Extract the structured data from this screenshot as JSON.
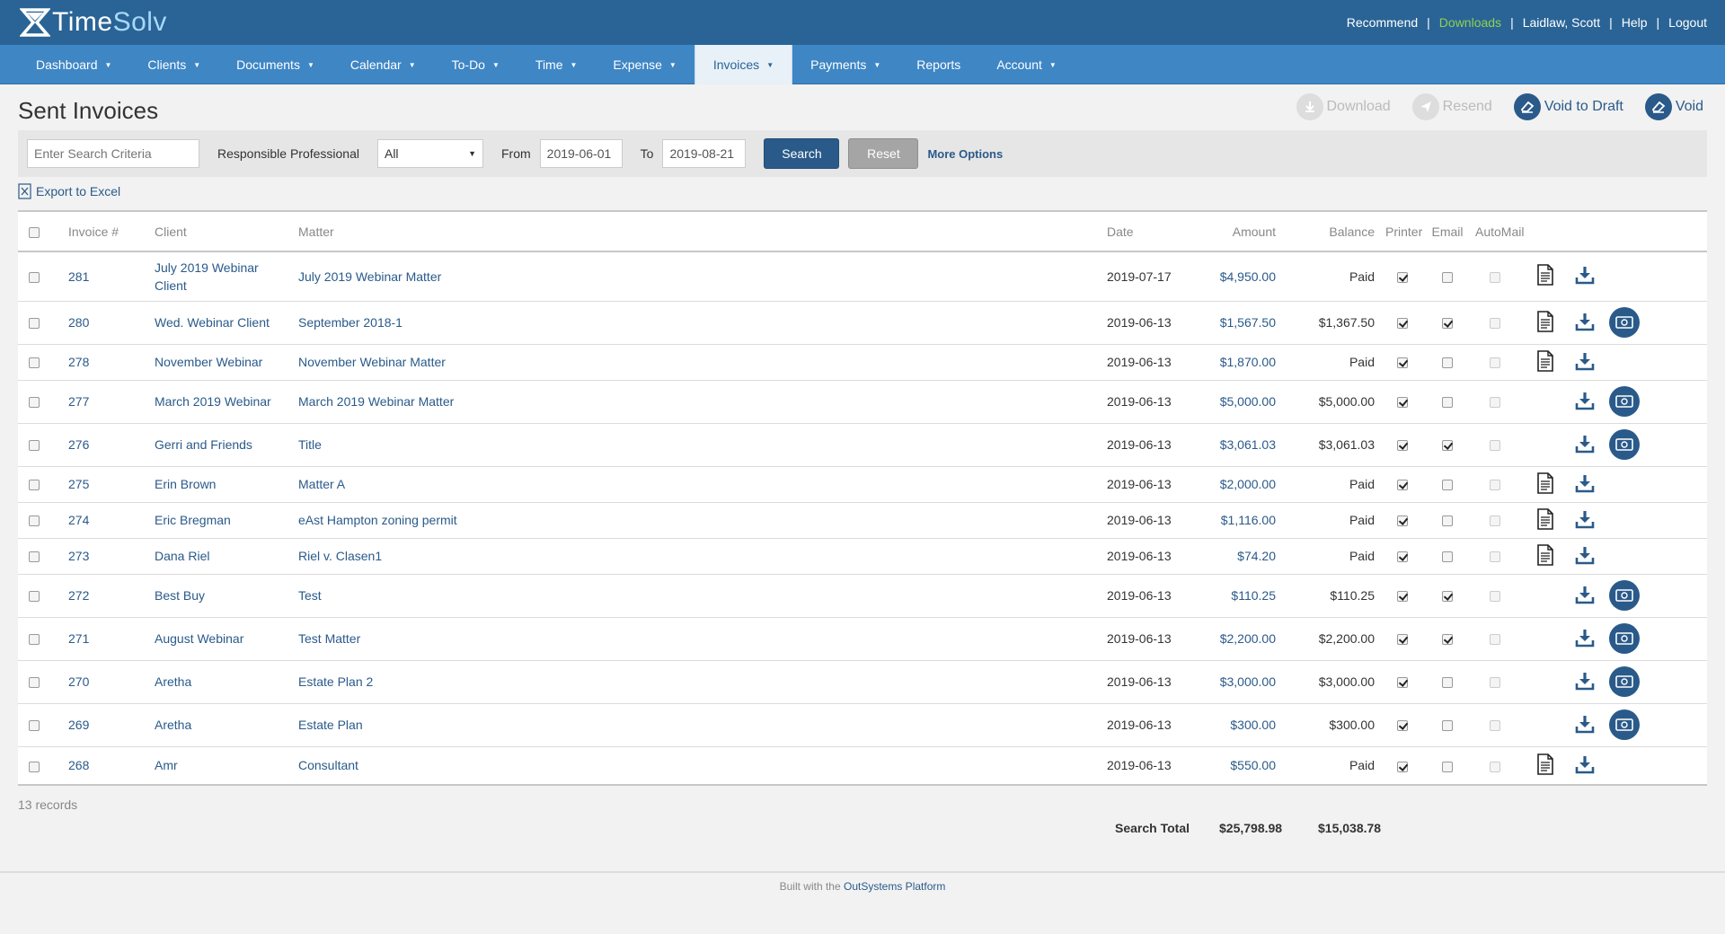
{
  "brand": {
    "name_time": "Time",
    "name_solv": "Solv"
  },
  "header_links": [
    {
      "label": "Recommend"
    },
    {
      "label": "Downloads"
    },
    {
      "label": "Laidlaw, Scott"
    },
    {
      "label": "Help"
    },
    {
      "label": "Logout"
    }
  ],
  "nav": [
    {
      "label": "Dashboard",
      "caret": true
    },
    {
      "label": "Clients",
      "caret": true
    },
    {
      "label": "Documents",
      "caret": true
    },
    {
      "label": "Calendar",
      "caret": true
    },
    {
      "label": "To-Do",
      "caret": true
    },
    {
      "label": "Time",
      "caret": true
    },
    {
      "label": "Expense",
      "caret": true
    },
    {
      "label": "Invoices",
      "caret": true,
      "active": true
    },
    {
      "label": "Payments",
      "caret": true
    },
    {
      "label": "Reports",
      "caret": false
    },
    {
      "label": "Account",
      "caret": true
    }
  ],
  "page": {
    "title": "Sent Invoices"
  },
  "actions": {
    "download": "Download",
    "resend": "Resend",
    "void_to_draft": "Void to Draft",
    "void": "Void"
  },
  "search": {
    "placeholder": "Enter Search Criteria",
    "responsible_label": "Responsible Professional",
    "responsible_value": "All",
    "from_label": "From",
    "from_value": "2019-06-01",
    "to_label": "To",
    "to_value": "2019-08-21",
    "search_button": "Search",
    "reset_button": "Reset",
    "more_options": "More Options"
  },
  "export_label": "Export to Excel",
  "columns": {
    "invoice": "Invoice #",
    "client": "Client",
    "matter": "Matter",
    "date": "Date",
    "amount": "Amount",
    "balance": "Balance",
    "printer": "Printer",
    "email": "Email",
    "automail": "AutoMail"
  },
  "rows": [
    {
      "invoice": "281",
      "client": "July 2019 Webinar Client",
      "matter": "July 2019 Webinar Matter",
      "date": "2019-07-17",
      "amount": "$4,950.00",
      "balance": "Paid",
      "printer": true,
      "email": false,
      "doc": true,
      "pay": false
    },
    {
      "invoice": "280",
      "client": "Wed. Webinar Client",
      "matter": "September 2018-1",
      "date": "2019-06-13",
      "amount": "$1,567.50",
      "balance": "$1,367.50",
      "printer": true,
      "email": true,
      "doc": true,
      "pay": true
    },
    {
      "invoice": "278",
      "client": "November Webinar",
      "matter": "November Webinar Matter",
      "date": "2019-06-13",
      "amount": "$1,870.00",
      "balance": "Paid",
      "printer": true,
      "email": false,
      "doc": true,
      "pay": false
    },
    {
      "invoice": "277",
      "client": "March 2019 Webinar",
      "matter": "March 2019 Webinar Matter",
      "date": "2019-06-13",
      "amount": "$5,000.00",
      "balance": "$5,000.00",
      "printer": true,
      "email": false,
      "doc": false,
      "pay": true
    },
    {
      "invoice": "276",
      "client": "Gerri and Friends",
      "matter": "Title",
      "date": "2019-06-13",
      "amount": "$3,061.03",
      "balance": "$3,061.03",
      "printer": true,
      "email": true,
      "doc": false,
      "pay": true
    },
    {
      "invoice": "275",
      "client": "Erin Brown",
      "matter": "Matter A",
      "date": "2019-06-13",
      "amount": "$2,000.00",
      "balance": "Paid",
      "printer": true,
      "email": false,
      "doc": true,
      "pay": false
    },
    {
      "invoice": "274",
      "client": "Eric Bregman",
      "matter": "eAst Hampton zoning permit",
      "date": "2019-06-13",
      "amount": "$1,116.00",
      "balance": "Paid",
      "printer": true,
      "email": false,
      "doc": true,
      "pay": false
    },
    {
      "invoice": "273",
      "client": "Dana Riel",
      "matter": "Riel v. Clasen1",
      "date": "2019-06-13",
      "amount": "$74.20",
      "balance": "Paid",
      "printer": true,
      "email": false,
      "doc": true,
      "pay": false
    },
    {
      "invoice": "272",
      "client": "Best Buy",
      "matter": "Test",
      "date": "2019-06-13",
      "amount": "$110.25",
      "balance": "$110.25",
      "printer": true,
      "email": true,
      "doc": false,
      "pay": true
    },
    {
      "invoice": "271",
      "client": "August Webinar",
      "matter": "Test Matter",
      "date": "2019-06-13",
      "amount": "$2,200.00",
      "balance": "$2,200.00",
      "printer": true,
      "email": true,
      "doc": false,
      "pay": true
    },
    {
      "invoice": "270",
      "client": "Aretha",
      "matter": "Estate Plan 2",
      "date": "2019-06-13",
      "amount": "$3,000.00",
      "balance": "$3,000.00",
      "printer": true,
      "email": false,
      "doc": false,
      "pay": true
    },
    {
      "invoice": "269",
      "client": "Aretha",
      "matter": "Estate Plan",
      "date": "2019-06-13",
      "amount": "$300.00",
      "balance": "$300.00",
      "printer": true,
      "email": false,
      "doc": false,
      "pay": true
    },
    {
      "invoice": "268",
      "client": "Amr",
      "matter": "Consultant",
      "date": "2019-06-13",
      "amount": "$550.00",
      "balance": "Paid",
      "printer": true,
      "email": false,
      "doc": true,
      "pay": false
    }
  ],
  "records_text": "13 records",
  "totals": {
    "label": "Search Total",
    "amount": "$25,798.98",
    "balance": "$15,038.78"
  },
  "footer": {
    "prefix": "Built with the",
    "link": "OutSystems Platform"
  }
}
